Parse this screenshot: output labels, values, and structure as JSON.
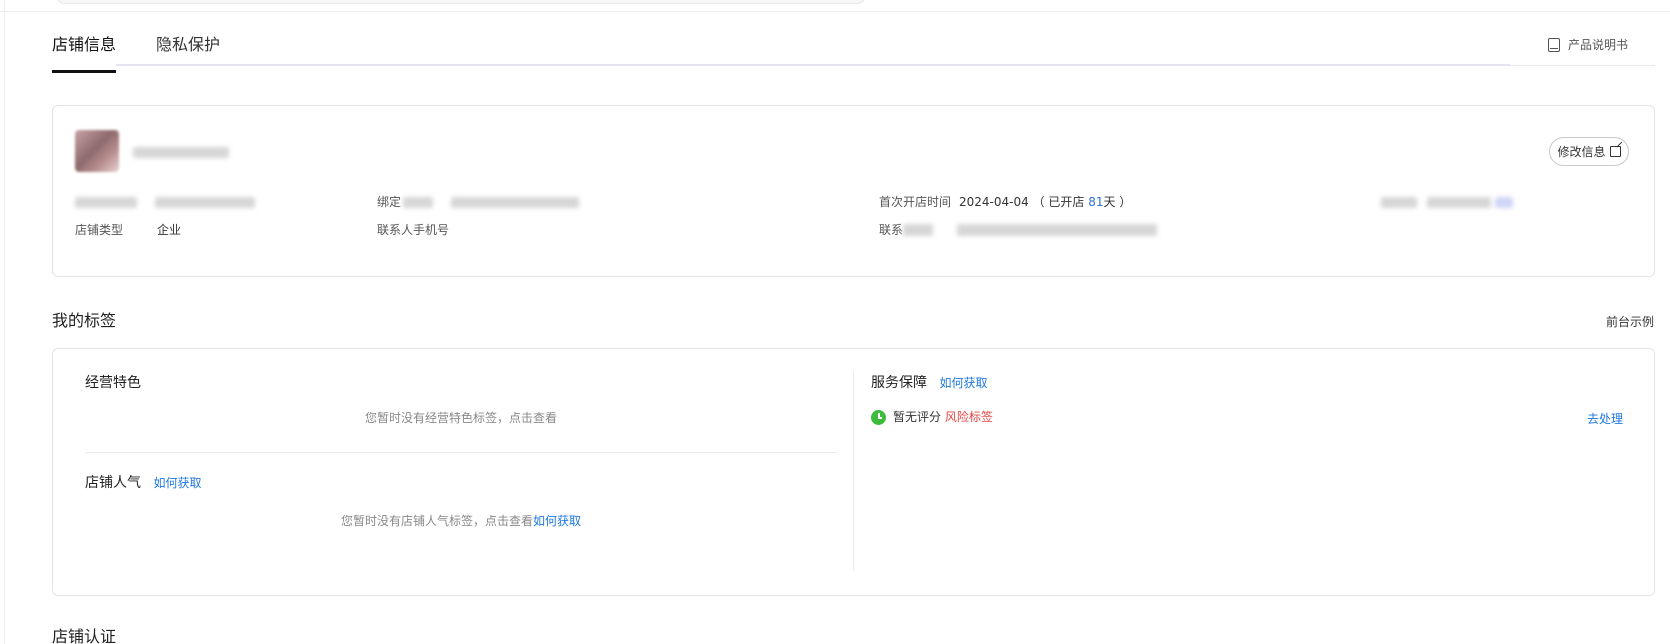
{
  "tabs": [
    {
      "label": "店铺信息",
      "active": true
    },
    {
      "label": "隐私保护",
      "active": false
    }
  ],
  "manual_link": {
    "label": "产品说明书",
    "icon": "book-icon"
  },
  "shop_info": {
    "edit_button": "修改信息",
    "bound_label_prefix": "绑定",
    "shop_type_label": "店铺类型",
    "shop_type_value": "企业",
    "contact_phone_label": "联系人手机号",
    "first_open_label": "首次开店时间",
    "first_open_date": "2024-04-04",
    "open_days_prefix": "（ 已开店 ",
    "open_days": "81",
    "open_days_suffix": "天 ）",
    "contact_prefix": "联系"
  },
  "my_tags": {
    "title": "我的标签",
    "example_link": "前台示例",
    "business_features": {
      "title": "经营特色",
      "empty_text": "您暂时没有经营特色标签，点击查看"
    },
    "popularity": {
      "title": "店铺人气",
      "how_link": "如何获取",
      "empty_text": "您暂时没有店铺人气标签，点击查看",
      "empty_link": "如何获取"
    },
    "service": {
      "title": "服务保障",
      "how_link": "如何获取",
      "status_text": "暂无评分",
      "risk_label": "风险标签",
      "action": "去处理"
    }
  },
  "certification": {
    "title": "店铺认证"
  },
  "colors": {
    "accent": "#1f78e0",
    "risk": "#e64545",
    "status_ok": "#3dbb3d"
  }
}
